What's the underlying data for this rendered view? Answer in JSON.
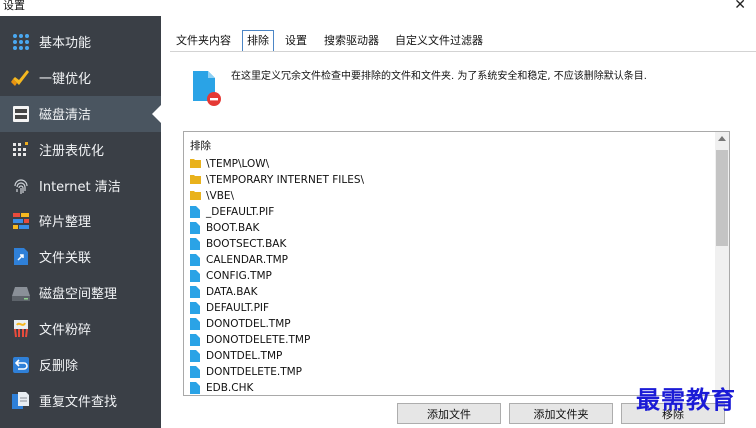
{
  "window": {
    "title": "设置",
    "close_glyph": "✕"
  },
  "sidebar": {
    "items": [
      {
        "label": "基本功能",
        "icon": "grid-dots-icon",
        "active": false
      },
      {
        "label": "一键优化",
        "icon": "broom-icon",
        "active": false
      },
      {
        "label": "磁盘清洁",
        "icon": "disk-chip-icon",
        "active": true
      },
      {
        "label": "注册表优化",
        "icon": "registry-dots-icon",
        "active": false
      },
      {
        "label": "Internet 清洁",
        "icon": "fingerprint-icon",
        "active": false
      },
      {
        "label": "碎片整理",
        "icon": "defrag-blocks-icon",
        "active": false
      },
      {
        "label": "文件关联",
        "icon": "file-link-icon",
        "active": false
      },
      {
        "label": "磁盘空间整理",
        "icon": "drive-icon",
        "active": false
      },
      {
        "label": "文件粉碎",
        "icon": "shredder-icon",
        "active": false
      },
      {
        "label": "反删除",
        "icon": "undelete-icon",
        "active": false
      },
      {
        "label": "重复文件查找",
        "icon": "duplicate-files-icon",
        "active": false
      }
    ]
  },
  "tabs": [
    {
      "label": "文件夹内容",
      "active": false
    },
    {
      "label": "排除",
      "active": true
    },
    {
      "label": "设置",
      "active": false
    },
    {
      "label": "搜索驱动器",
      "active": false
    },
    {
      "label": "自定义文件过滤器",
      "active": false
    }
  ],
  "info": {
    "text": "在这里定义冗余文件检查中要排除的文件和文件夹. 为了系统安全和稳定, 不应该删除默认条目."
  },
  "list": {
    "header": "排除",
    "items": [
      {
        "name": "\\TEMP\\LOW\\",
        "type": "folder"
      },
      {
        "name": "\\TEMPORARY INTERNET FILES\\",
        "type": "folder"
      },
      {
        "name": "\\VBE\\",
        "type": "folder"
      },
      {
        "name": "_DEFAULT.PIF",
        "type": "file"
      },
      {
        "name": "BOOT.BAK",
        "type": "file"
      },
      {
        "name": "BOOTSECT.BAK",
        "type": "file"
      },
      {
        "name": "CALENDAR.TMP",
        "type": "file"
      },
      {
        "name": "CONFIG.TMP",
        "type": "file"
      },
      {
        "name": "DATA.BAK",
        "type": "file"
      },
      {
        "name": "DEFAULT.PIF",
        "type": "file"
      },
      {
        "name": "DONOTDEL.TMP",
        "type": "file"
      },
      {
        "name": "DONOTDELETE.TMP",
        "type": "file"
      },
      {
        "name": "DONTDEL.TMP",
        "type": "file"
      },
      {
        "name": "DONTDELETE.TMP",
        "type": "file"
      },
      {
        "name": "EDB.CHK",
        "type": "file"
      }
    ]
  },
  "buttons": {
    "add_file": "添加文件",
    "add_folder": "添加文件夹",
    "remove": "移除"
  },
  "watermark": "最需教育",
  "colors": {
    "sidebar_bg": "#3a3f46",
    "sidebar_active": "#4a5560",
    "file_icon": "#2aa3e6",
    "folder_icon": "#e9b21c",
    "watermark": "#1b1bd6",
    "tab_active_border": "#4c86c6"
  }
}
